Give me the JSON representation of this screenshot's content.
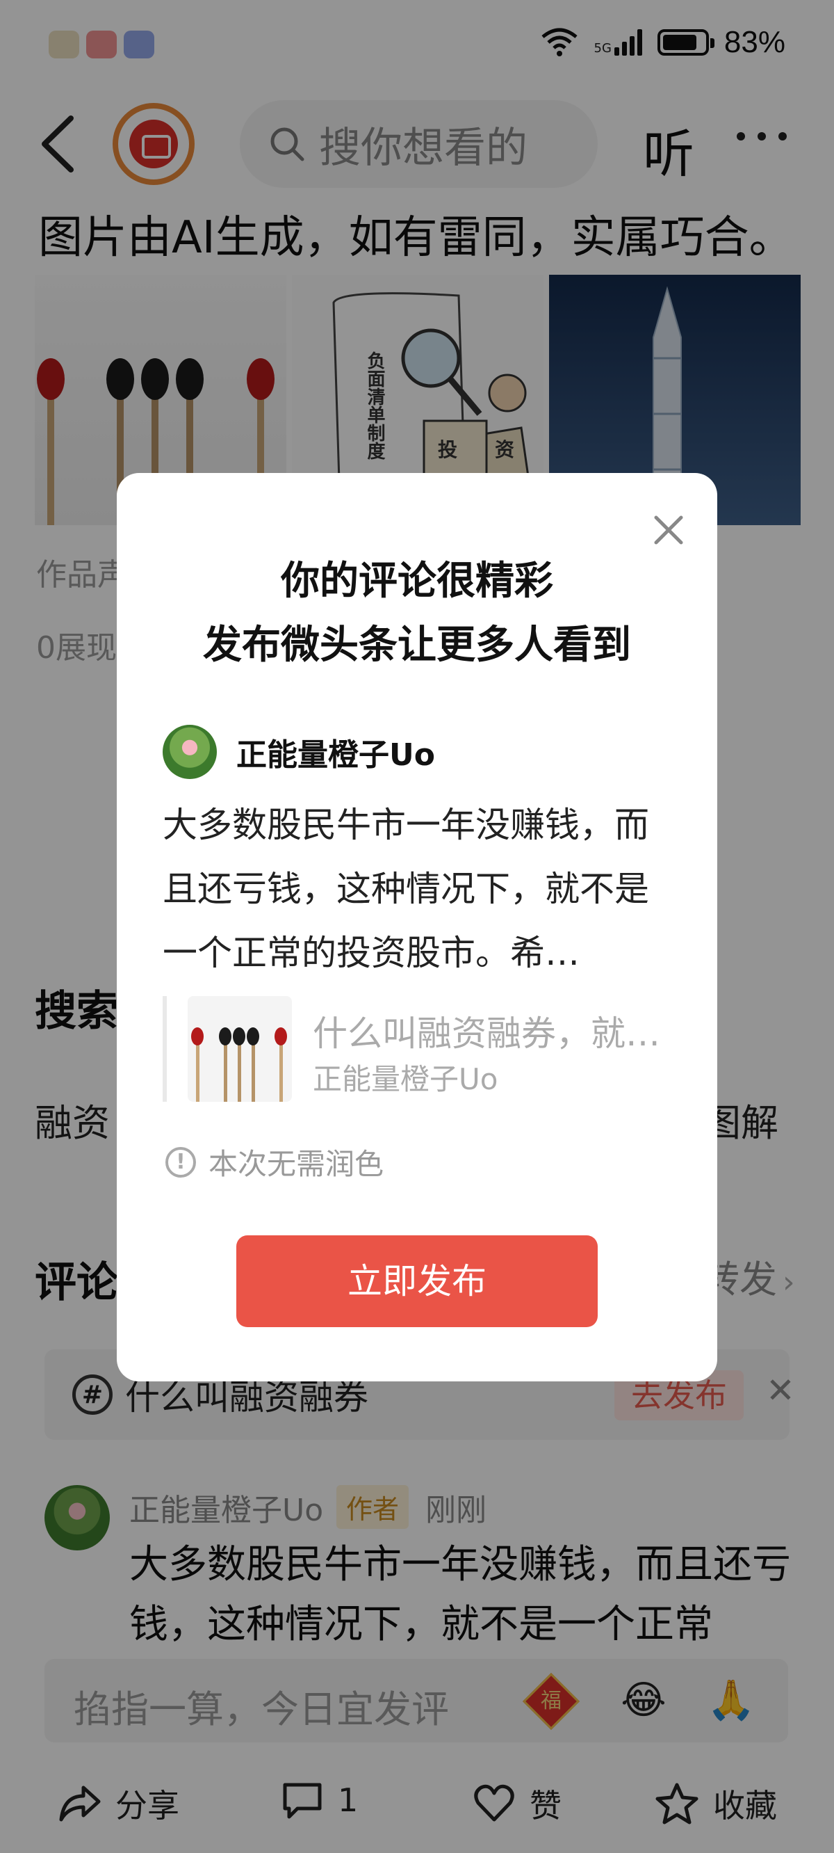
{
  "status_bar": {
    "battery": "83%",
    "network": "5G"
  },
  "header": {
    "search_placeholder": "搜你想看的",
    "listen_label": "听"
  },
  "article": {
    "ai_note": "图片由AI生成，如有雷同，实属巧合。",
    "thumb2_vertical": "负面清单制度",
    "thumb2_badge_a": "投",
    "thumb2_badge_b": "资",
    "statement_partial": "作品声",
    "views_partial": "0展现"
  },
  "search_section": {
    "heading_partial": "搜索",
    "left_partial": "融资",
    "right_partial": "图解"
  },
  "comments_section": {
    "heading_partial": "评论",
    "forward_partial": "转发",
    "topic": {
      "text": "什么叫融资融券",
      "publish_label": "去发布"
    },
    "comment": {
      "author": "正能量橙子Uo",
      "badge": "作者",
      "time": "刚刚",
      "text": "大多数股民牛市一年没赚钱，而且还亏钱，这种情况下，就不是一个正常"
    }
  },
  "input": {
    "placeholder": "掐指一算，今日宜发评",
    "fu_char": "福"
  },
  "bottom_bar": {
    "share": "分享",
    "comment_count": "1",
    "like": "赞",
    "collect": "收藏"
  },
  "dialog": {
    "title_line1": "你的评论很精彩",
    "title_line2": "发布微头条让更多人看到",
    "username": "正能量橙子Uo",
    "text": "大多数股民牛市一年没赚钱，而且还亏钱，这种情况下，就不是一个正常的投资股市。希…",
    "quote_title": "什么叫融资融券，就…",
    "quote_author": "正能量橙子Uo",
    "hint": "本次无需润色",
    "publish_button": "立即发布"
  }
}
